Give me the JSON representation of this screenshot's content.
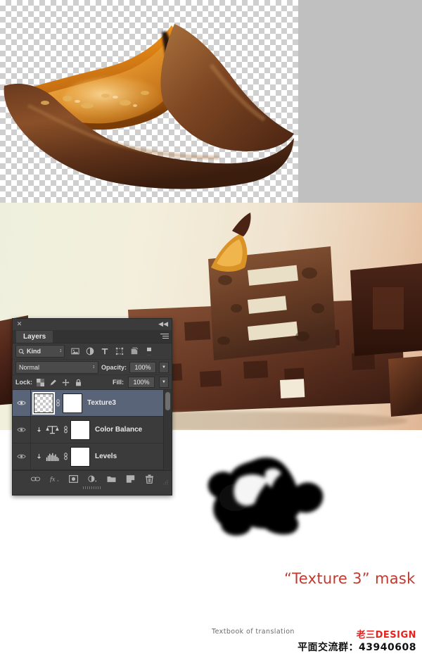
{
  "canvas": {
    "transparency_label": "transparency-checkerboard",
    "gray_pane_color": "#c0c0c0",
    "checker_light": "#ffffff",
    "checker_dark": "#cfcfcf"
  },
  "scene": {
    "background_start": "#eef0dd",
    "background_end": "#e0b695",
    "description": "3D chocolate typography scene"
  },
  "mask": {
    "shape_label": "texture-3-layer-mask-blob",
    "fill_color": "#000000"
  },
  "captions": {
    "mask_caption": "“Texture 3” mask",
    "mask_caption_color": "#c0392f",
    "textbook": "Textbook of translation",
    "watermark_design": "老三DESIGN",
    "watermark_design_color": "#e8211c",
    "watermark_qq": "平面交流群：43940608"
  },
  "panel": {
    "title": "Layers",
    "close_glyph": "✕",
    "collapse_glyph": "◀◀",
    "menu_icon": "panel-menu-icon",
    "filter": {
      "kind_label": "Kind",
      "search_icon": "search-icon",
      "stepper_glyph": "↕",
      "icons": [
        {
          "name": "filter-pixel-icon",
          "label": "Pixel layers"
        },
        {
          "name": "filter-adjustment-icon",
          "label": "Adjustment layers"
        },
        {
          "name": "filter-type-icon",
          "label": "Type layers"
        },
        {
          "name": "filter-shape-icon",
          "label": "Shape layers"
        },
        {
          "name": "filter-smart-object-icon",
          "label": "Smart objects"
        },
        {
          "name": "filter-toggle-icon",
          "label": "Filter toggle"
        }
      ]
    },
    "blend": {
      "mode": "Normal",
      "opacity_label": "Opacity:",
      "opacity_value": "100%",
      "fill_label": "Fill:",
      "fill_value": "100%",
      "arrow_glyph": "▼",
      "stepper_glyph": "↕"
    },
    "lock": {
      "label": "Lock:",
      "icons": [
        {
          "name": "lock-transparent-pixels-icon",
          "label": "Lock transparent pixels"
        },
        {
          "name": "lock-image-pixels-icon",
          "label": "Lock image pixels"
        },
        {
          "name": "lock-position-icon",
          "label": "Lock position"
        },
        {
          "name": "lock-all-icon",
          "label": "Lock all"
        }
      ]
    },
    "layers": [
      {
        "name": "Texture3",
        "visible": true,
        "selected": true,
        "thumb_kind": "checker",
        "has_mask": true,
        "mask_kind": "white",
        "linked": true,
        "adjustment_icon": null,
        "clipped": false
      },
      {
        "name": "Color Balance",
        "visible": true,
        "selected": false,
        "thumb_kind": "adjustment",
        "has_mask": true,
        "mask_kind": "white",
        "linked": true,
        "adjustment_icon": "color-balance-icon",
        "clipped": true
      },
      {
        "name": "Levels",
        "visible": true,
        "selected": false,
        "thumb_kind": "adjustment",
        "has_mask": true,
        "mask_kind": "white",
        "linked": true,
        "adjustment_icon": "levels-icon",
        "clipped": true
      }
    ],
    "footer_buttons": [
      {
        "name": "link-layers-button",
        "label": "Link layers"
      },
      {
        "name": "layer-style-fx-button",
        "label": "Add a layer style"
      },
      {
        "name": "add-layer-mask-button",
        "label": "Add layer mask"
      },
      {
        "name": "new-adjustment-layer-button",
        "label": "Create new fill or adjustment layer"
      },
      {
        "name": "new-group-button",
        "label": "Create a new group"
      },
      {
        "name": "new-layer-button",
        "label": "Create a new layer"
      },
      {
        "name": "delete-layer-button",
        "label": "Delete layer"
      }
    ]
  }
}
